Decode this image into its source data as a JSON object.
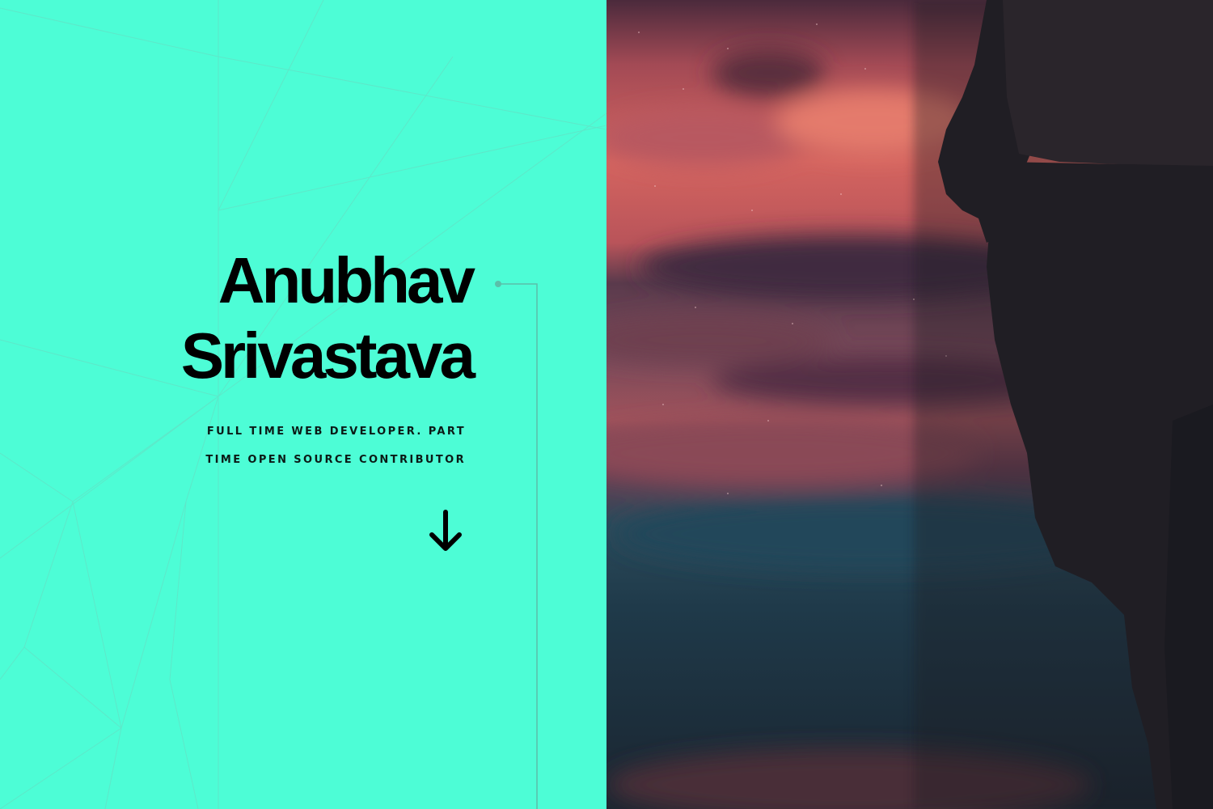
{
  "hero": {
    "name_line1": "Anubhav",
    "name_line2": "Srivastava",
    "tagline_line1": "FULL TIME WEB DEVELOPER. PART",
    "tagline_line2": "TIME OPEN SOURCE CONTRIBUTOR",
    "scroll_icon": "arrow-down-icon"
  },
  "colors": {
    "accent_background": "#4dfdd6",
    "text": "#000000",
    "connector_line": "#5bbfa9"
  },
  "photo": {
    "subject": "silhouette-person-against-pink-dusk-sky"
  }
}
